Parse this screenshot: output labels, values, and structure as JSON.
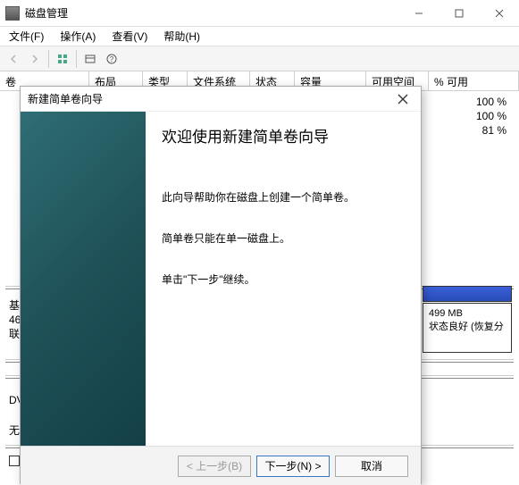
{
  "window": {
    "title": "磁盘管理"
  },
  "menu": {
    "file": "文件(F)",
    "action": "操作(A)",
    "view": "查看(V)",
    "help": "帮助(H)"
  },
  "columns": {
    "volume": "卷",
    "layout": "布局",
    "type": "类型",
    "filesystem": "文件系统",
    "status": "状态",
    "capacity": "容量",
    "free": "可用空间",
    "pct": "% 可用"
  },
  "rows_pct": [
    "100 %",
    "100 %",
    "81 %"
  ],
  "disk_box": {
    "size": "499 MB",
    "status": "状态良好 (恢复分"
  },
  "back_labels": {
    "l1a": "基",
    "l1b": "46",
    "l1c": "联",
    "l2a": "DV",
    "l3a": "无"
  },
  "wizard": {
    "title": "新建简单卷向导",
    "heading": "欢迎使用新建简单卷向导",
    "p1": "此向导帮助你在磁盘上创建一个简单卷。",
    "p2": "简单卷只能在单一磁盘上。",
    "p3": "单击\"下一步\"继续。",
    "back": "< 上一步(B)",
    "next": "下一步(N) >",
    "cancel": "取消"
  }
}
